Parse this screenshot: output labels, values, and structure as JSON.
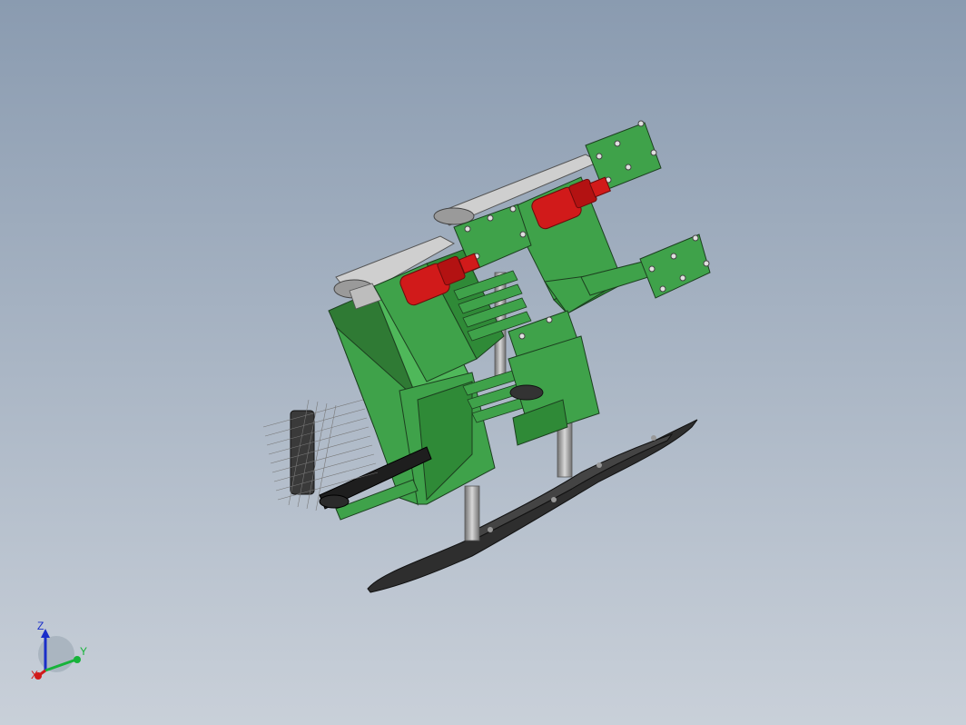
{
  "viewport": {
    "background_top": "#8a9bb0",
    "background_bottom": "#c9d0d9"
  },
  "model": {
    "name": "",
    "part_color": "#3fa24a",
    "motor_color": "#d11a1a",
    "plate_color": "#3a3a3a",
    "shaft_color": "#a9a9a9"
  },
  "triad": {
    "z_label": "Z",
    "y_label": "Y",
    "x_label": "X",
    "z_color": "#1a2ec9",
    "y_color": "#17b33a",
    "x_color": "#d11a1a"
  }
}
